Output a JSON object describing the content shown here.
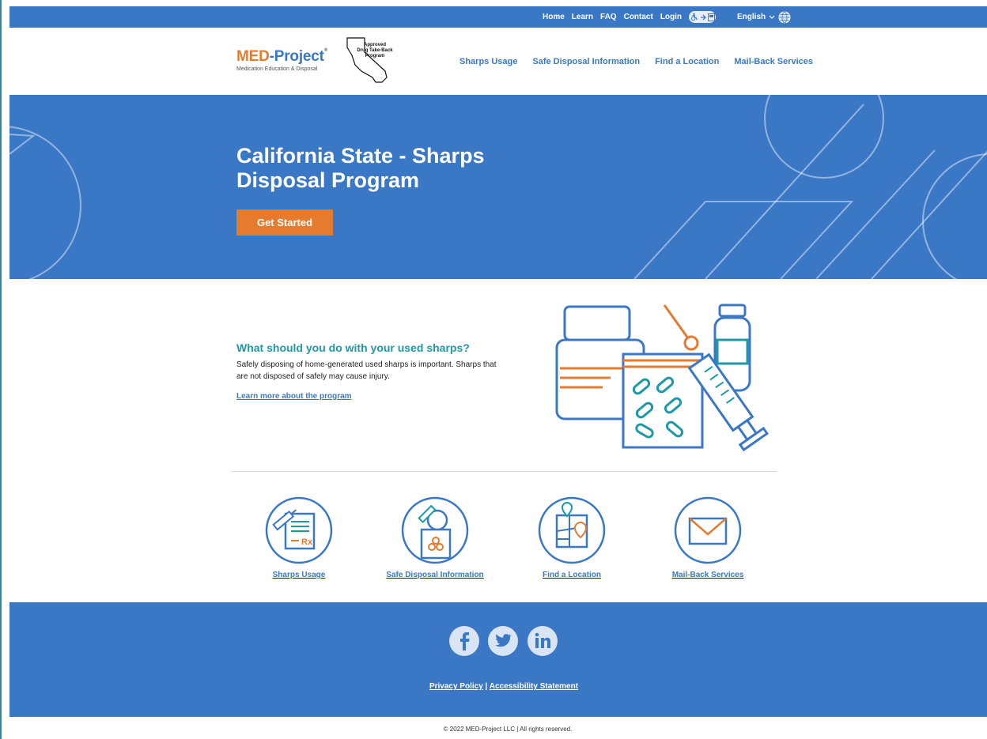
{
  "topbar": {
    "links": [
      "Home",
      "Learn",
      "FAQ",
      "Contact",
      "Login"
    ],
    "language": "English"
  },
  "header": {
    "logo_title_a": "MED",
    "logo_title_b": "-Project",
    "logo_reg": "®",
    "logo_sub": "Medication Education & Disposal",
    "badge_line1": "Approved",
    "badge_line2": "Drug Take-Back",
    "badge_line3": "Program",
    "nav": [
      "Sharps Usage",
      "Safe Disposal Information",
      "Find a Location",
      "Mail-Back Services"
    ]
  },
  "hero": {
    "title": "California State - Sharps Disposal Program",
    "button": "Get Started"
  },
  "info": {
    "heading": "What should you do with your used sharps?",
    "text": "Safely disposing of home-generated used sharps is important. Sharps that are not disposed of safely may cause injury.",
    "link": "Learn more about the program"
  },
  "features": [
    {
      "label": "Sharps Usage",
      "icon": "prescription-syringe-icon"
    },
    {
      "label": "Safe Disposal Information",
      "icon": "biohazard-container-icon"
    },
    {
      "label": "Find a Location",
      "icon": "map-pin-icon"
    },
    {
      "label": "Mail-Back Services",
      "icon": "envelope-icon"
    }
  ],
  "footer": {
    "social": [
      "facebook-icon",
      "twitter-icon",
      "linkedin-icon"
    ],
    "privacy": "Privacy Policy",
    "separator": "|",
    "accessibility": "Accessibility Statement",
    "copyright": "© 2022 MED-Project LLC | All rights reserved."
  },
  "colors": {
    "brand_blue": "#3a78c6",
    "accent_orange": "#e57b2f",
    "teal": "#1e9aa7"
  }
}
